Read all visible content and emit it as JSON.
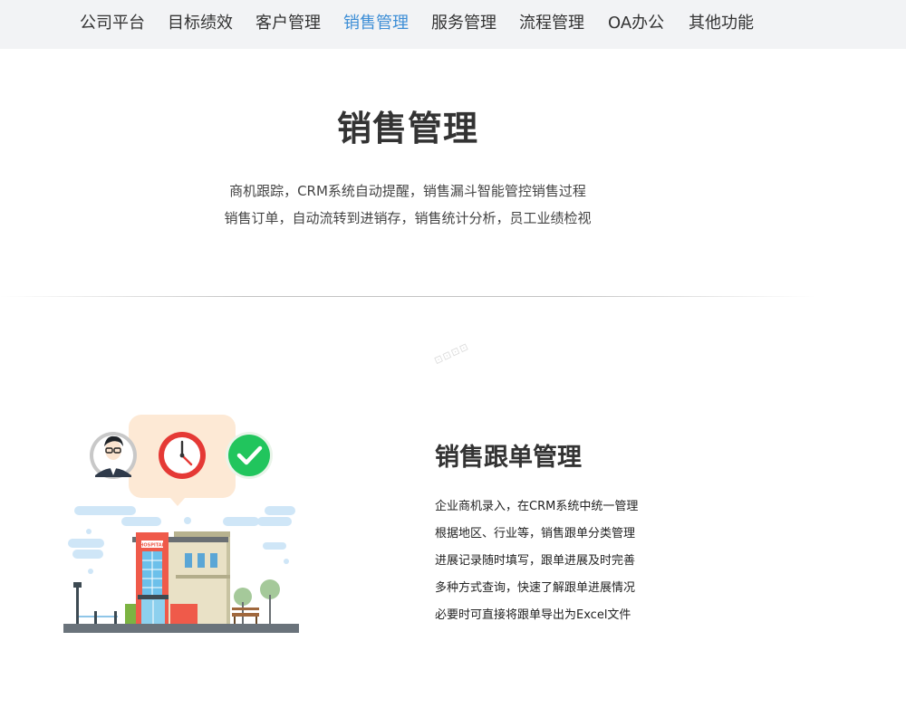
{
  "nav": {
    "items": [
      "公司平台",
      "目标绩效",
      "客户管理",
      "销售管理",
      "服务管理",
      "流程管理",
      "OA办公",
      "其他功能"
    ],
    "active": "销售管理"
  },
  "header": {
    "title": "销售管理",
    "intro": [
      "商机跟踪，CRM系统自动提醒，销售漏斗智能管控销售过程",
      "销售订单，自动流转到进销存，销售统计分析，员工业绩检视"
    ]
  },
  "feature": {
    "title": "销售跟单管理",
    "lines": [
      "企业商机录入，在CRM系统中统一管理",
      "根据地区、行业等，销售跟单分类管理",
      "进展记录随时填写，跟单进展及时完善",
      "多种方式查询，快速了解跟单进展情况",
      "必要时可直接将跟单导出为Excel文件"
    ],
    "illustration": {
      "sign_text": "HOSPITAL",
      "icons": [
        "person-avatar-icon",
        "clock-icon",
        "checkmark-icon"
      ]
    }
  },
  "watermark": "⊡⊡⊡⊡",
  "colors": {
    "nav_bg": "#f2f3f5",
    "active_accent": "#3d8ed6",
    "check_green": "#21c55d",
    "clock_red": "#e53935",
    "speech_bubble": "#fde9d5"
  }
}
